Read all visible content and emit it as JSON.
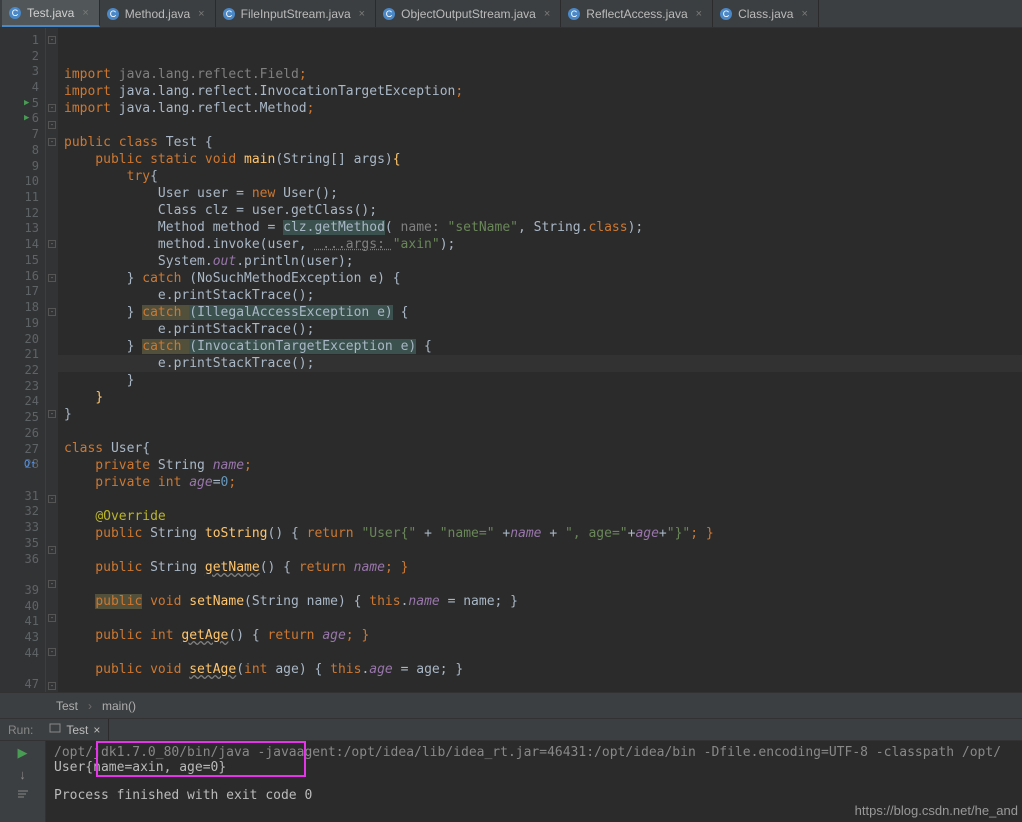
{
  "tabs": [
    {
      "label": "Test.java",
      "active": true,
      "kind": "class"
    },
    {
      "label": "Method.java",
      "active": false,
      "kind": "class"
    },
    {
      "label": "FileInputStream.java",
      "active": false,
      "kind": "class"
    },
    {
      "label": "ObjectOutputStream.java",
      "active": false,
      "kind": "class"
    },
    {
      "label": "ReflectAccess.java",
      "active": false,
      "kind": "class"
    },
    {
      "label": "Class.java",
      "active": false,
      "kind": "class"
    }
  ],
  "line_numbers": [
    "1",
    "2",
    "3",
    "4",
    "5",
    "6",
    "7",
    "8",
    "9",
    "10",
    "11",
    "12",
    "13",
    "14",
    "15",
    "16",
    "17",
    "18",
    "19",
    "20",
    "21",
    "22",
    "23",
    "24",
    "25",
    "26",
    "27",
    "28",
    "",
    "31",
    "32",
    "33",
    "35",
    "36",
    "",
    "39",
    "40",
    "41",
    "43",
    "44",
    "",
    "47"
  ],
  "run_markers": {
    "5": true,
    "6": true
  },
  "override_marker_line": "28",
  "code": {
    "l1": {
      "a": "import ",
      "b": "java.lang.reflect.Field",
      "c": ";"
    },
    "l2": {
      "a": "import ",
      "b": "java.lang.reflect.InvocationTargetException",
      "c": ";"
    },
    "l3": {
      "a": "import ",
      "b": "java.lang.reflect.Method",
      "c": ";"
    },
    "l5": {
      "a": "public class ",
      "b": "Test ",
      "c": "{"
    },
    "l6": {
      "a": "    public static void ",
      "b": "main",
      "c": "(String[] args)",
      "d": "{"
    },
    "l7": {
      "a": "        try",
      "b": "{"
    },
    "l8": {
      "a": "            User user = ",
      "b": "new ",
      "c": "User();"
    },
    "l9": {
      "a": "            Class clz = user.getClass();"
    },
    "l10": {
      "a": "            Method method = ",
      "b": "clz.getMethod",
      "c": "(",
      "d": " name: ",
      "e": "\"setName\"",
      "f": ", String.",
      "g": "class",
      "h": ");"
    },
    "l11": {
      "a": "            method.invoke(user, ",
      "b": " ...args: ",
      "c": "\"axin\"",
      "d": ");"
    },
    "l12": {
      "a": "            System.",
      "b": "out",
      "c": ".println(user);"
    },
    "l13": {
      "a": "        } ",
      "b": "catch ",
      "c": "(NoSuchMethodException e) {"
    },
    "l14": {
      "a": "            e.printStackTrace();"
    },
    "l15": {
      "a": "        } ",
      "b": "catch ",
      "c": "(IllegalAccessException e)",
      "d": " {"
    },
    "l16": {
      "a": "            e.printStackTrace();"
    },
    "l17": {
      "a": "        } ",
      "b": "catch ",
      "c": "(InvocationTargetException e)",
      "d": " {"
    },
    "l18": {
      "a": "            e.printStackTrace();"
    },
    "l19": {
      "a": "        }"
    },
    "l20": {
      "a": "    ",
      "b": "}"
    },
    "l21": {
      "a": "}"
    },
    "l23": {
      "a": "class ",
      "b": "User",
      "c": "{"
    },
    "l24": {
      "a": "    private ",
      "b": "String ",
      "c": "name",
      "d": ";"
    },
    "l25": {
      "a": "    private int ",
      "b": "age",
      "c": "=",
      "d": "0",
      "e": ";"
    },
    "l27": {
      "a": "    ",
      "b": "@Override"
    },
    "l28": {
      "a": "    public ",
      "b": "String ",
      "c": "toString",
      "d": "() { ",
      "e": "return ",
      "f": "\"User{\"",
      "g": " + ",
      "h": "\"name=\"",
      "i": " +",
      "j": "name ",
      "k": "+ ",
      "l": "\", age=\"",
      "m": "+",
      "n": "age",
      "o": "+",
      "p": "\"}\"",
      "q": "; }"
    },
    "l32": {
      "a": "    public ",
      "b": "String ",
      "c": "getName",
      "d": "() { ",
      "e": "return ",
      "f": "name",
      "g": "; }"
    },
    "l36": {
      "a": "    ",
      "b": "public",
      "c": " void ",
      "d": "setName",
      "e": "(String name) { ",
      "f": "this",
      "g": ".",
      "h": "name ",
      "i": "= name; }"
    },
    "l40": {
      "a": "    public int ",
      "b": "getAge",
      "c": "() { ",
      "d": "return ",
      "e": "age",
      "f": "; }"
    },
    "l44": {
      "a": "    public void ",
      "b": "setAge",
      "c": "(",
      "d": "int ",
      "e": "age) { ",
      "f": "this",
      "g": ".",
      "h": "age ",
      "i": "= age; }"
    },
    "l47": {
      "a": "}"
    }
  },
  "breadcrumb": {
    "a": "Test",
    "b": "main()"
  },
  "run": {
    "title": "Run:",
    "tab": "Test",
    "line1": "/opt/jdk1.7.0_80/bin/java -javaagent:/opt/idea/lib/idea_rt.jar=46431:/opt/idea/bin -Dfile.encoding=UTF-8 -classpath /opt/",
    "line2": "User{name=axin, age=0}",
    "line3": "Process finished with exit code 0"
  },
  "watermark": "https://blog.csdn.net/he_and"
}
